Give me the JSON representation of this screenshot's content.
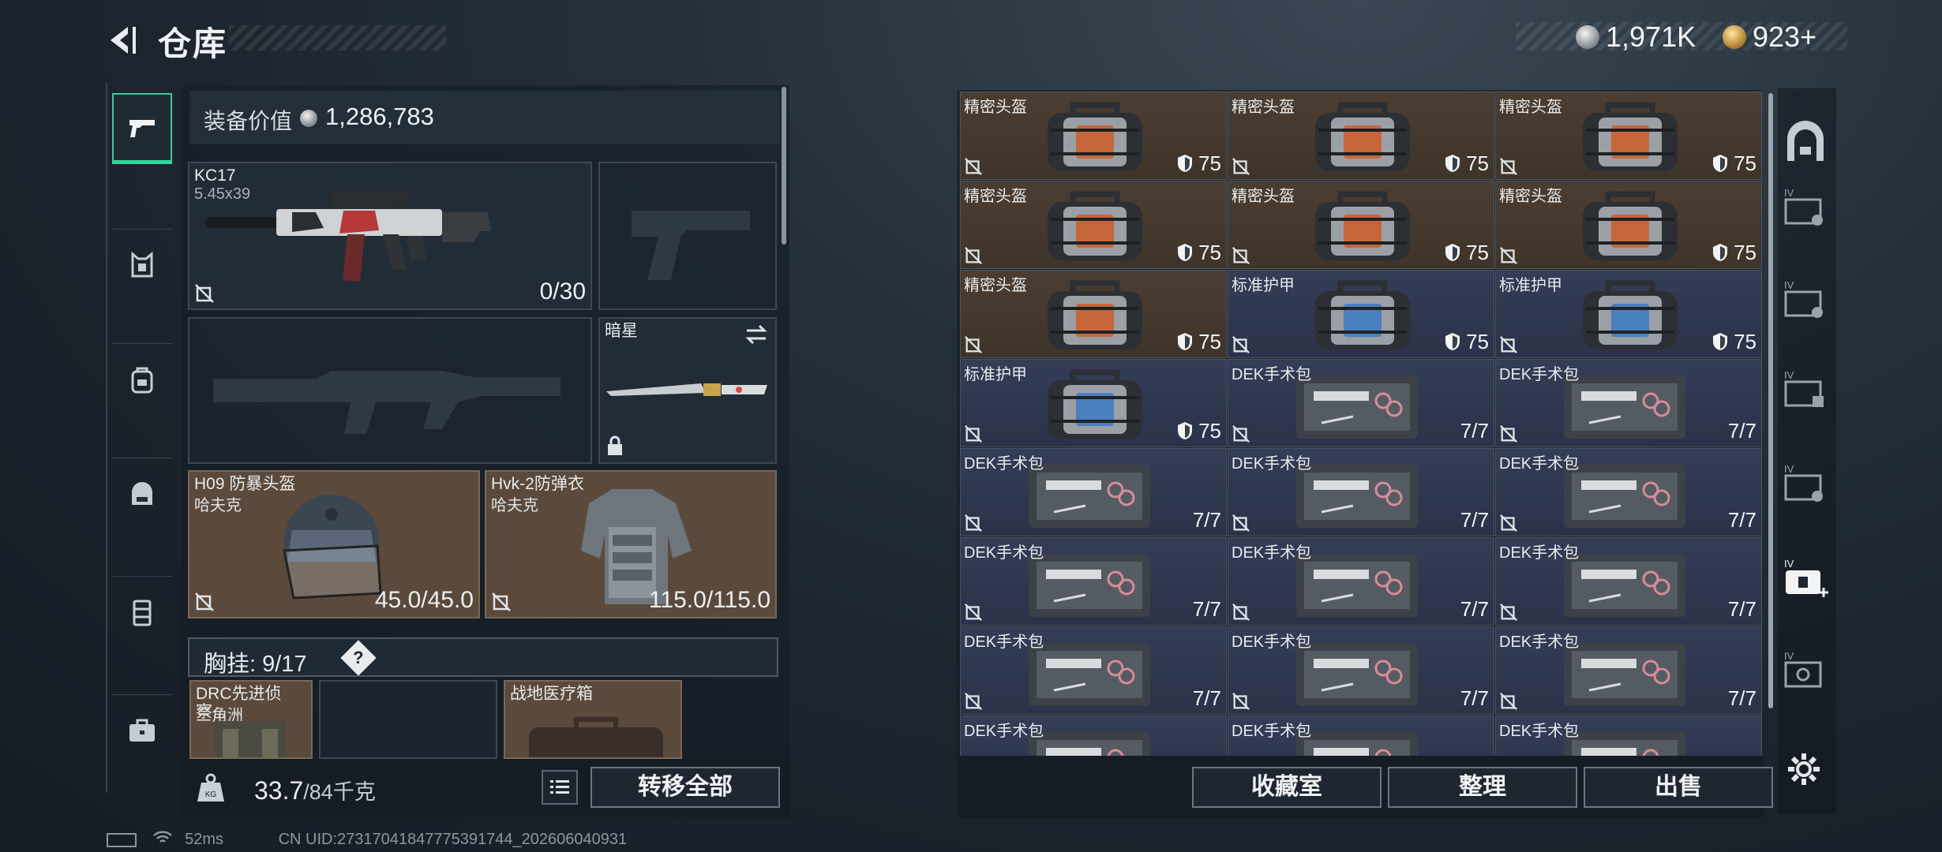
{
  "header": {
    "title": "仓库"
  },
  "currency": {
    "silver": "1,971K",
    "gold": "923+"
  },
  "equipment": {
    "value_label": "装备价值",
    "value": "1,286,783",
    "primary": {
      "name": "KC17",
      "caliber": "5.45x39",
      "ammo": "0/30"
    },
    "melee": {
      "name": "暗星"
    },
    "helmet": {
      "name": "H09 防暴头盔",
      "brand": "哈夫克",
      "durability": "45.0/45.0"
    },
    "armor": {
      "name": "Hvk-2防弹衣",
      "brand": "哈夫克",
      "durability": "115.0/115.0"
    },
    "chest": {
      "label": "胸挂:",
      "capacity": "9/17",
      "help": "?"
    },
    "chest_items": [
      {
        "name": "DRC先进侦察...",
        "sub": "三角洲"
      },
      {
        "name": "",
        "sub": ""
      },
      {
        "name": "战地医疗箱",
        "sub": ""
      }
    ]
  },
  "weight": {
    "current": "33.7",
    "max": "/84千克"
  },
  "actions": {
    "transfer_all": "转移全部",
    "collection": "收藏室",
    "organize": "整理",
    "sell": "出售"
  },
  "inventory": [
    {
      "name": "精密头盔",
      "value": "75",
      "kind": "helmet"
    },
    {
      "name": "精密头盔",
      "value": "75",
      "kind": "helmet"
    },
    {
      "name": "精密头盔",
      "value": "75",
      "kind": "helmet"
    },
    {
      "name": "精密头盔",
      "value": "75",
      "kind": "helmet"
    },
    {
      "name": "精密头盔",
      "value": "75",
      "kind": "helmet"
    },
    {
      "name": "精密头盔",
      "value": "75",
      "kind": "helmet"
    },
    {
      "name": "精密头盔",
      "value": "75",
      "kind": "helmet"
    },
    {
      "name": "标准护甲",
      "value": "75",
      "kind": "armor"
    },
    {
      "name": "标准护甲",
      "value": "75",
      "kind": "armor"
    },
    {
      "name": "标准护甲",
      "value": "75",
      "kind": "armor"
    },
    {
      "name": "DEK手术包",
      "value": "7/7",
      "kind": "kit"
    },
    {
      "name": "DEK手术包",
      "value": "7/7",
      "kind": "kit"
    },
    {
      "name": "DEK手术包",
      "value": "7/7",
      "kind": "kit"
    },
    {
      "name": "DEK手术包",
      "value": "7/7",
      "kind": "kit"
    },
    {
      "name": "DEK手术包",
      "value": "7/7",
      "kind": "kit"
    },
    {
      "name": "DEK手术包",
      "value": "7/7",
      "kind": "kit"
    },
    {
      "name": "DEK手术包",
      "value": "7/7",
      "kind": "kit"
    },
    {
      "name": "DEK手术包",
      "value": "7/7",
      "kind": "kit"
    },
    {
      "name": "DEK手术包",
      "value": "7/7",
      "kind": "kit"
    },
    {
      "name": "DEK手术包",
      "value": "7/7",
      "kind": "kit"
    },
    {
      "name": "DEK手术包",
      "value": "7/7",
      "kind": "kit"
    },
    {
      "name": "DEK手术包",
      "value": "",
      "kind": "kit"
    },
    {
      "name": "DEK手术包",
      "value": "",
      "kind": "kit"
    },
    {
      "name": "DEK手术包",
      "value": "",
      "kind": "kit"
    }
  ],
  "status": {
    "ping": "52ms",
    "uid": "CN UID:27317041847775391744_202606040931"
  }
}
